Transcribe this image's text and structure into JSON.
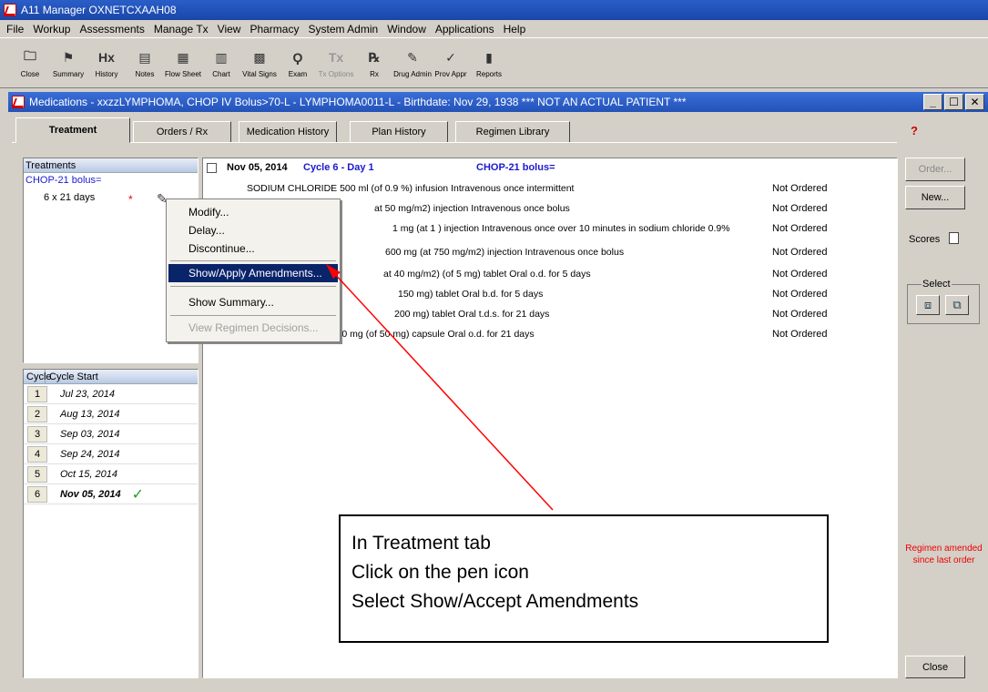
{
  "app": {
    "title": "A11 Manager OXNETCXAAH08"
  },
  "menu": [
    "File",
    "Workup",
    "Assessments",
    "Manage Tx",
    "View",
    "Pharmacy",
    "System Admin",
    "Window",
    "Applications",
    "Help"
  ],
  "toolbar": [
    {
      "label": "Close",
      "icon": "folder-icon",
      "glyph": "🗀",
      "enabled": true
    },
    {
      "label": "Summary",
      "icon": "flag-icon",
      "glyph": "⚑",
      "enabled": true
    },
    {
      "label": "History",
      "icon": "hx-icon",
      "glyph": "Hx",
      "enabled": true
    },
    {
      "label": "Notes",
      "icon": "notes-icon",
      "glyph": "▤",
      "enabled": true
    },
    {
      "label": "Flow Sheet",
      "icon": "grid-icon",
      "glyph": "▦",
      "enabled": true
    },
    {
      "label": "Chart",
      "icon": "chart-icon",
      "glyph": "▥",
      "enabled": true
    },
    {
      "label": "Vital Signs",
      "icon": "vitals-icon",
      "glyph": "▩",
      "enabled": true
    },
    {
      "label": "Exam",
      "icon": "stethoscope-icon",
      "glyph": "Ϙ",
      "enabled": true
    },
    {
      "label": "Tx Options",
      "icon": "tx-icon",
      "glyph": "Tx",
      "enabled": false
    },
    {
      "label": "Rx",
      "icon": "rx-icon",
      "glyph": "℞",
      "enabled": true
    },
    {
      "label": "Drug Admin",
      "icon": "pen-icon",
      "glyph": "✎",
      "enabled": true
    },
    {
      "label": "Prov Appr",
      "icon": "approve-icon",
      "glyph": "✓",
      "enabled": true
    },
    {
      "label": "Reports",
      "icon": "reports-icon",
      "glyph": "▮",
      "enabled": true
    }
  ],
  "child_window": {
    "title": "Medications - xxzzLYMPHOMA, CHOP IV Bolus>70-L  - LYMPHOMA0011-L - Birthdate: Nov 29, 1938 *** NOT AN ACTUAL PATIENT ***",
    "tabs": [
      "Treatment",
      "Orders / Rx",
      "Medication History",
      "Plan History",
      "Regimen Library"
    ]
  },
  "treatments": {
    "header": "Treatments",
    "regimen": "CHOP-21 bolus=",
    "schedule": "6 x 21 days",
    "marker": "*"
  },
  "orders": {
    "date": "Nov 05, 2014",
    "cycle_day": "Cycle 6 - Day 1",
    "regimen": "CHOP-21 bolus=",
    "rows": [
      {
        "text": "SODIUM CHLORIDE 500 ml (of 0.9 %) infusion Intravenous once intermittent",
        "status": "Not Ordered"
      },
      {
        "text": "at 50 mg/m2) injection Intravenous once bolus",
        "status": "Not Ordered"
      },
      {
        "text": "1 mg (at 1 ) injection Intravenous once over 10 minutes in sodium chloride 0.9%",
        "status": "Not Ordered"
      },
      {
        "text": "600 mg (at 750 mg/m2) injection Intravenous once bolus",
        "status": "Not Ordered"
      },
      {
        "text": "at 40 mg/m2) (of 5 mg) tablet Oral o.d. for 5 days",
        "status": "Not Ordered"
      },
      {
        "text": "150 mg) tablet Oral b.d. for 5 days",
        "status": "Not Ordered"
      },
      {
        "text": "200 mg) tablet Oral t.d.s. for 21 days",
        "status": "Not Ordered"
      },
      {
        "text": "FLUCONAZOLE 50 mg (of 50 mg) capsule Oral o.d. for 21 days",
        "status": "Not Ordered"
      }
    ]
  },
  "context_menu": {
    "items": [
      "Modify...",
      "Delay...",
      "Discontinue...",
      "Show/Apply Amendments...",
      "Show Summary...",
      "View Regimen Decisions..."
    ]
  },
  "cycles": {
    "headers": [
      "Cycle",
      "Cycle Start"
    ],
    "rows": [
      {
        "num": "1",
        "date": "Jul 23, 2014"
      },
      {
        "num": "2",
        "date": "Aug 13, 2014"
      },
      {
        "num": "3",
        "date": "Sep 03, 2014"
      },
      {
        "num": "4",
        "date": "Sep 24, 2014"
      },
      {
        "num": "5",
        "date": "Oct 15, 2014"
      },
      {
        "num": "6",
        "date": "Nov 05, 2014",
        "current": true
      }
    ]
  },
  "right_panel": {
    "order_label": "Order...",
    "new_label": "New...",
    "scores_label": "Scores",
    "select_label": "Select",
    "amended_text": "Regimen amended since last order",
    "close_label": "Close"
  },
  "callout": {
    "lines": [
      "In Treatment tab",
      "Click on the pen icon",
      "Select Show/Accept Amendments"
    ]
  },
  "colors": {
    "accent_blue": "#1a1ad0",
    "menu_highlight": "#0a246a",
    "warning_red": "#ff0000",
    "arrow_red": "#ff0000"
  }
}
